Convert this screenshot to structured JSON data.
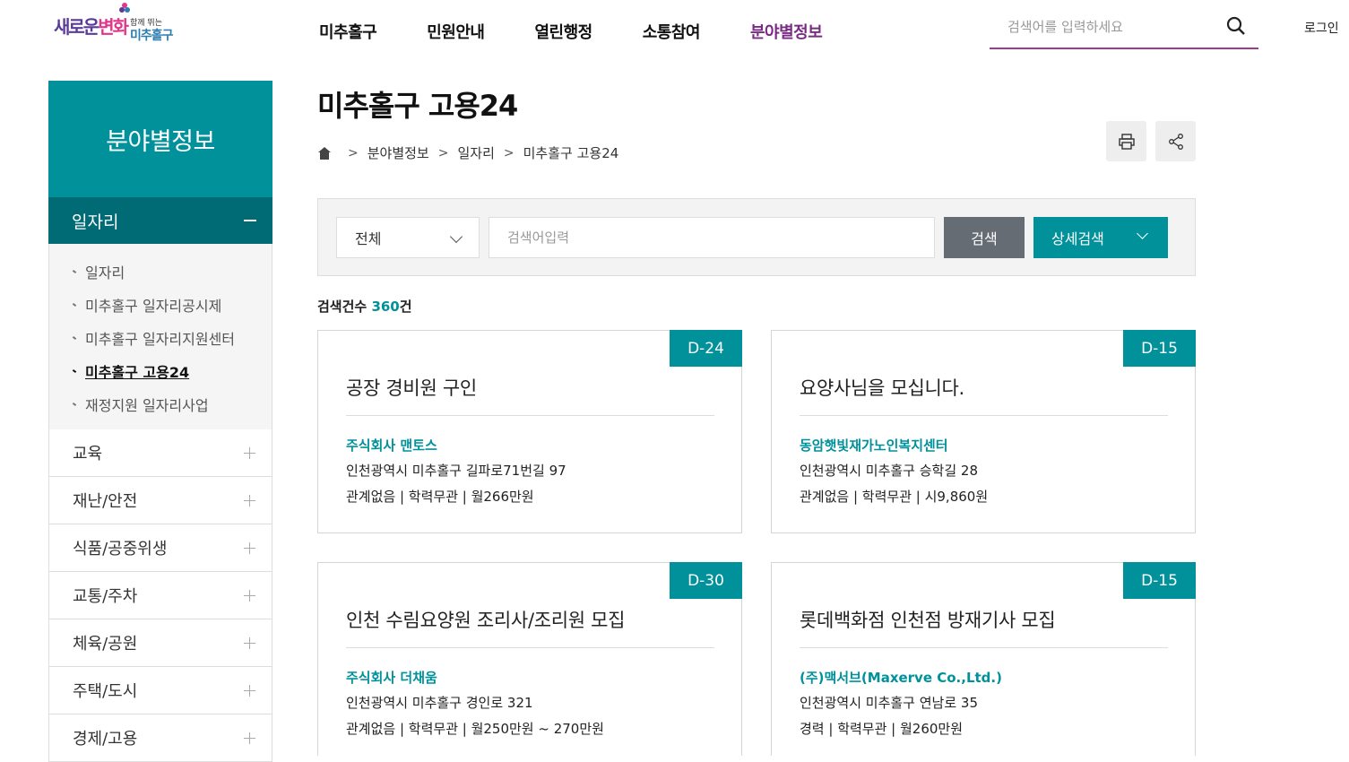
{
  "header": {
    "logo": {
      "line1a": "새로운",
      "line1b": "변화",
      "line2": "함께 뛰는",
      "line3": "미추홀구"
    },
    "nav": [
      "미추홀구",
      "민원안내",
      "열린행정",
      "소통참여",
      "분야별정보"
    ],
    "search_placeholder": "검색어를 입력하세요",
    "login": "로그인"
  },
  "sidebar": {
    "title": "분야별정보",
    "active": "일자리",
    "sub_items": [
      "일자리",
      "미추홀구 일자리공시제",
      "미추홀구 일자리지원센터",
      "미추홀구 고용24",
      "재정지원 일자리사업"
    ],
    "menu_items": [
      "교육",
      "재난/안전",
      "식품/공중위생",
      "교통/주차",
      "체육/공원",
      "주택/도시",
      "경제/고용"
    ]
  },
  "main": {
    "title": "미추홀구 고용24",
    "breadcrumb": [
      "분야별정보",
      "일자리",
      "미추홀구 고용24"
    ],
    "search": {
      "select": "전체",
      "placeholder": "검색어입력",
      "search_btn": "검색",
      "detail_btn": "상세검색"
    },
    "count_label": "검색건수",
    "count_value": "360",
    "count_unit": "건",
    "cards": [
      {
        "dday": "D-24",
        "title": "공장 경비원 구인",
        "company": "주식회사 맨토스",
        "address": "인천광역시 미추홀구 길파로71번길 97",
        "cond": "관계없음 | 학력무관 | 월266만원"
      },
      {
        "dday": "D-15",
        "title": "요양사님을 모십니다.",
        "company": "동암햇빛재가노인복지센터",
        "address": "인천광역시 미추홀구 승학길 28",
        "cond": "관계없음 | 학력무관 | 시9,860원"
      },
      {
        "dday": "D-30",
        "title": "인천 수림요양원 조리사/조리원 모집",
        "company": "주식회사 더채움",
        "address": "인천광역시 미추홀구 경인로 321",
        "cond": "관계없음 | 학력무관 | 월250만원 ~ 270만원"
      },
      {
        "dday": "D-15",
        "title": "롯데백화점 인천점 방재기사 모집",
        "company": "(주)맥서브(Maxerve Co.,Ltd.)",
        "address": "인천광역시 미추홀구 연남로 35",
        "cond": "경력 | 학력무관 | 월260만원"
      }
    ]
  },
  "colors": {
    "teal": "#00919b",
    "dark_teal": "#006b75",
    "purple": "#7a2c84"
  }
}
